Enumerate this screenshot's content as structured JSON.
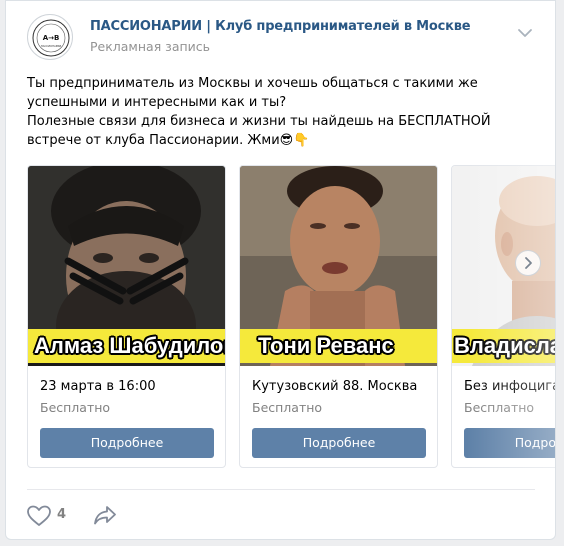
{
  "post": {
    "group_name": "ПАССИОНАРИИ | Клуб предпринимателей в Москве",
    "ad_label": "Рекламная запись",
    "avatar_text": "A→B",
    "avatar_sub": "ПАССИОНАРИИ",
    "text_lines": [
      "Ты предприниматель из Москвы и хочешь общаться с такими же успешными и интересными как и ты?",
      "Полезные связи для бизнеса и жизни ты найдешь на БЕСПЛАТНОЙ встрече от клуба Пассионарии. Жми😎👇"
    ]
  },
  "cards": [
    {
      "banner": "Алмаз Шабудилов",
      "title": "23 марта в 16:00",
      "subtitle": "Бесплатно",
      "button": "Подробнее"
    },
    {
      "banner": "Тони Реванс",
      "title": "Кутузовский 88. Москва",
      "subtitle": "Бесплатно",
      "button": "Подробнее"
    },
    {
      "banner": "Владислав",
      "title": "Без инфоциган",
      "subtitle": "Бесплатно",
      "button": "Подробнее"
    }
  ],
  "footer": {
    "likes": "4"
  },
  "colors": {
    "link": "#2a5885",
    "button": "#5e81a8",
    "banner": "#f5e93b"
  }
}
